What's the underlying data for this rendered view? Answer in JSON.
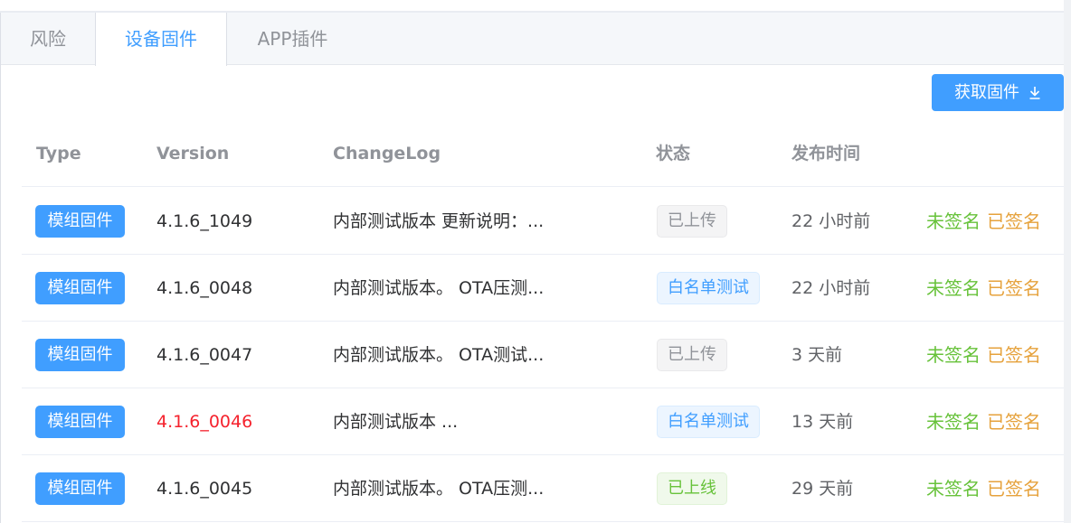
{
  "tabs": [
    {
      "label": "风险"
    },
    {
      "label": "设备固件"
    },
    {
      "label": "APP插件"
    }
  ],
  "toolbar": {
    "fetch_label": "获取固件",
    "fetch_icon": "download-icon"
  },
  "colors": {
    "primary": "#409eff",
    "danger": "#f5222d",
    "success": "#67c23a",
    "warning": "#e6a23c"
  },
  "table": {
    "headers": {
      "type": "Type",
      "version": "Version",
      "changelog": "ChangeLog",
      "status": "状态",
      "published": "发布时间"
    },
    "rows": [
      {
        "type": "模组固件",
        "version": "4.1.6_1049",
        "version_highlight": false,
        "changelog": "内部测试版本 更新说明：...",
        "status": "已上传",
        "status_kind": "uploaded",
        "time": "22 小时前",
        "unsigned": "未签名",
        "signed": "已签名"
      },
      {
        "type": "模组固件",
        "version": "4.1.6_0048",
        "version_highlight": false,
        "changelog": "内部测试版本。 OTA压测...",
        "status": "白名单测试",
        "status_kind": "whitelist",
        "time": "22 小时前",
        "unsigned": "未签名",
        "signed": "已签名"
      },
      {
        "type": "模组固件",
        "version": "4.1.6_0047",
        "version_highlight": false,
        "changelog": "内部测试版本。 OTA测试...",
        "status": "已上传",
        "status_kind": "uploaded",
        "time": "3 天前",
        "unsigned": "未签名",
        "signed": "已签名"
      },
      {
        "type": "模组固件",
        "version": "4.1.6_0046",
        "version_highlight": true,
        "changelog": "内部测试版本 ...",
        "status": "白名单测试",
        "status_kind": "whitelist",
        "time": "13 天前",
        "unsigned": "未签名",
        "signed": "已签名"
      },
      {
        "type": "模组固件",
        "version": "4.1.6_0045",
        "version_highlight": false,
        "changelog": "内部测试版本。 OTA压测...",
        "status": "已上线",
        "status_kind": "online",
        "time": "29 天前",
        "unsigned": "未签名",
        "signed": "已签名"
      }
    ]
  }
}
